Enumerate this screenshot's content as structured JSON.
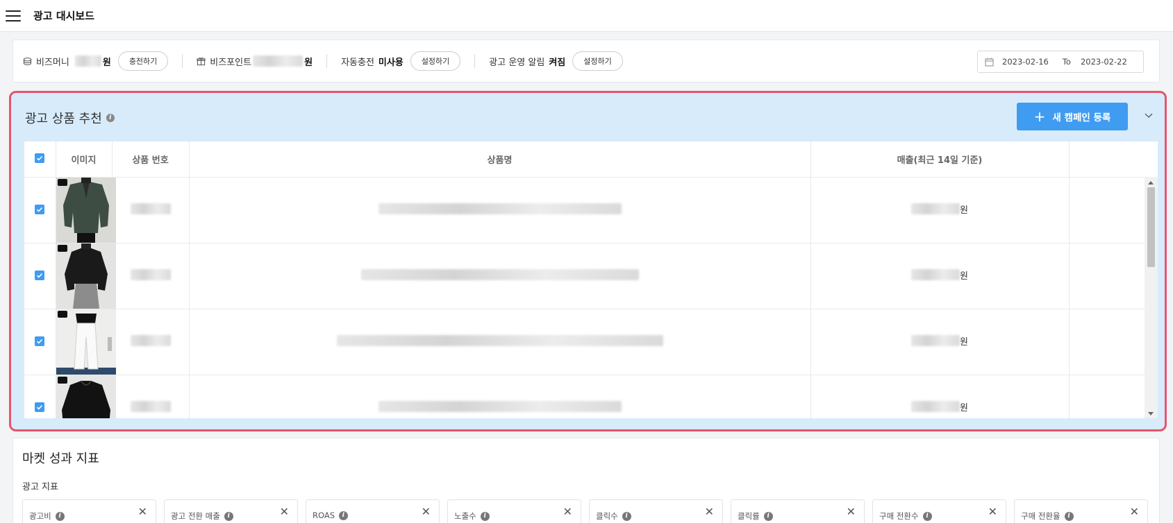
{
  "header": {
    "title": "광고 대시보드"
  },
  "bizbar": {
    "bizmoney_label": "비즈머니",
    "bizmoney_unit": "원",
    "charge_button": "충전하기",
    "bizpoint_label": "비즈포인트",
    "bizpoint_unit": "원",
    "autocharge_label": "자동충전",
    "autocharge_value": "미사용",
    "autocharge_button": "설정하기",
    "alert_label": "광고 운영 알림",
    "alert_value": "켜짐",
    "alert_button": "설정하기",
    "date_start": "2023-02-16",
    "date_to": "To",
    "date_end": "2023-02-22"
  },
  "recommendation": {
    "title": "광고 상품 추천",
    "new_campaign_button": "새 캠페인 등록",
    "columns": [
      "이미지",
      "상품 번호",
      "상품명",
      "매출(최근 14일 기준)"
    ],
    "rows": [
      {
        "checked": true,
        "revenue_unit": "원",
        "image": "green-cardigan"
      },
      {
        "checked": true,
        "revenue_unit": "원",
        "image": "black-cardigan"
      },
      {
        "checked": true,
        "revenue_unit": "원",
        "image": "white-pants"
      },
      {
        "checked": true,
        "revenue_unit": "원",
        "image": "black-sweater"
      }
    ]
  },
  "market": {
    "title": "마켓 성과 지표",
    "ad_metrics_label": "광고 지표",
    "metric_cards": [
      {
        "label": "광고비"
      },
      {
        "label": "광고 전환 매출"
      },
      {
        "label": "ROAS"
      },
      {
        "label": "노출수"
      },
      {
        "label": "클릭수"
      },
      {
        "label": "클릭률"
      },
      {
        "label": "구매 전환수"
      },
      {
        "label": "구매 전환율"
      }
    ]
  },
  "colors": {
    "accent": "#3f9cf1",
    "panel_bg": "#d7ebfb",
    "highlight_border": "#e5546b"
  }
}
